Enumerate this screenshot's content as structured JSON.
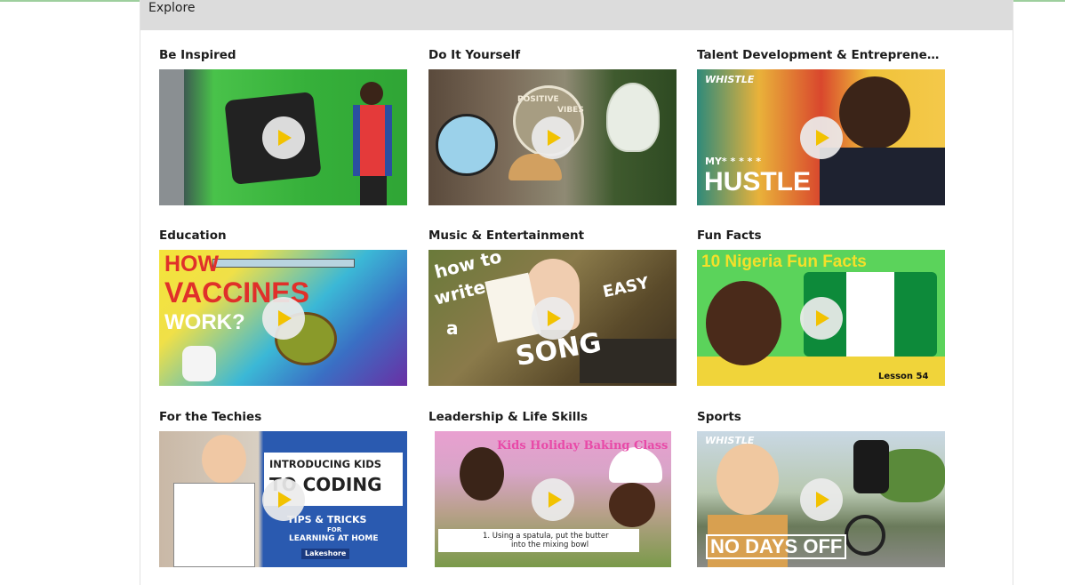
{
  "section": {
    "title": "Explore"
  },
  "cards": [
    {
      "title": "Be Inspired",
      "captions": []
    },
    {
      "title": "Do It Yourself",
      "captions": [
        "POSITIVE",
        "VIBES"
      ]
    },
    {
      "title": "Talent Development & Entrepreneursh...",
      "captions": [
        "WHISTLE",
        "MY* * * * *",
        "HUSTLE"
      ]
    },
    {
      "title": "Education",
      "captions": [
        "HOW",
        "VACCINES",
        "WORK?"
      ]
    },
    {
      "title": "Music & Entertainment",
      "captions": [
        "how to",
        "write",
        "a",
        "SONG",
        "EASY"
      ]
    },
    {
      "title": "Fun Facts",
      "captions": [
        "10 Nigeria Fun Facts",
        "Lesson 54"
      ]
    },
    {
      "title": "For the Techies",
      "captions": [
        "INTRODUCING KIDS",
        "TO CODING",
        "TIPS & TRICKS",
        "FOR",
        "LEARNING AT HOME",
        "Lakeshore"
      ]
    },
    {
      "title": "Leadership & Life Skills",
      "captions": [
        "Kids Holiday Baking Class",
        "1. Using a spatula, put the butter",
        "into the mixing bowl"
      ]
    },
    {
      "title": "Sports",
      "captions": [
        "WHISTLE",
        "NO DAYS OFF"
      ]
    }
  ],
  "colors": {
    "header_bg": "#dcdcdc",
    "play_triangle": "#f2c200"
  },
  "icons": {
    "play": "play-icon"
  }
}
